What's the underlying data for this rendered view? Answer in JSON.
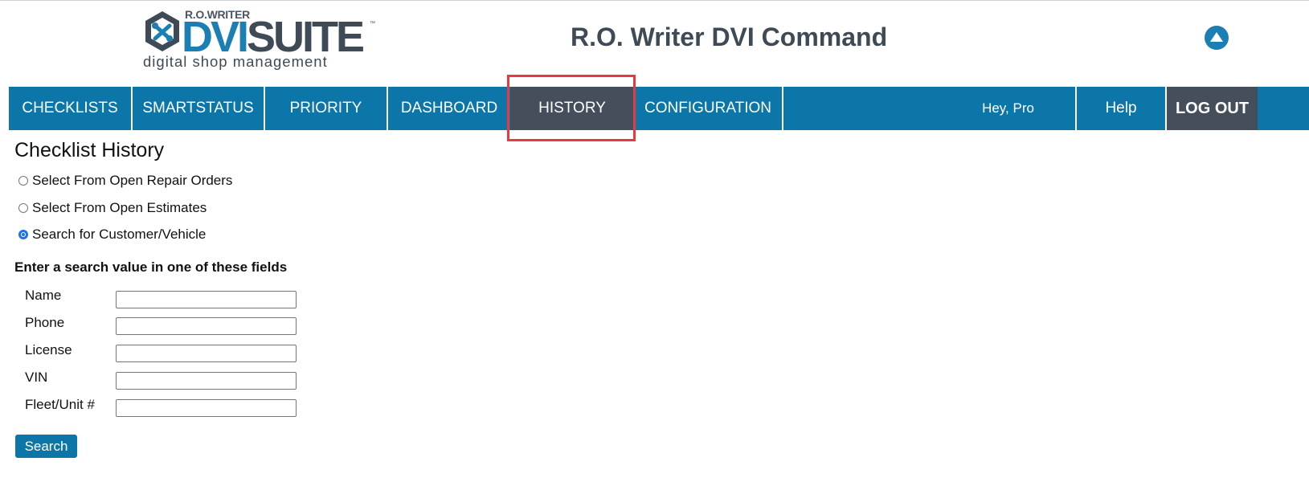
{
  "logo": {
    "brand_top": "R.O.WRITER",
    "brand_dvi": "DVI",
    "brand_suite": "SUITE",
    "trademark": "™",
    "tagline": "digital shop management"
  },
  "header": {
    "title": "R.O. Writer DVI Command",
    "up_icon": "chevron-up-circle-icon"
  },
  "nav": {
    "items": [
      {
        "label": "CHECKLISTS"
      },
      {
        "label": "SMARTSTATUS"
      },
      {
        "label": "PRIORITY"
      },
      {
        "label": "DASHBOARD"
      },
      {
        "label": "HISTORY",
        "active": true
      },
      {
        "label": "CONFIGURATION"
      }
    ],
    "greeting": "Hey, Pro",
    "help": "Help",
    "logout": "LOG OUT"
  },
  "colors": {
    "nav_bg": "#0d76a8",
    "nav_active": "#454f5c",
    "brand_blue": "#1c7fb3",
    "brand_gray": "#3f4a57",
    "highlight": "#e8393f"
  },
  "content": {
    "title": "Checklist History",
    "options": [
      {
        "label": "Select From Open Repair Orders",
        "checked": false
      },
      {
        "label": "Select From Open Estimates",
        "checked": false
      },
      {
        "label": "Search for Customer/Vehicle",
        "checked": true
      }
    ],
    "instruction": "Enter a search value in one of these fields",
    "fields": [
      {
        "label": "Name",
        "value": ""
      },
      {
        "label": "Phone",
        "value": ""
      },
      {
        "label": "License",
        "value": ""
      },
      {
        "label": "VIN",
        "value": ""
      },
      {
        "label": "Fleet/Unit #",
        "value": ""
      }
    ],
    "search_button": "Search"
  }
}
